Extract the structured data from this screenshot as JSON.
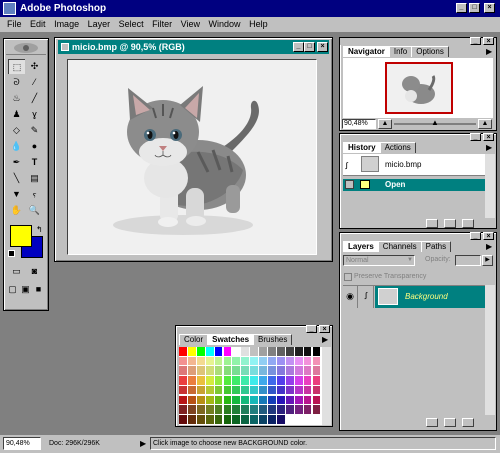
{
  "app": {
    "title": "Adobe Photoshop"
  },
  "menu": [
    "File",
    "Edit",
    "Image",
    "Layer",
    "Select",
    "Filter",
    "View",
    "Window",
    "Help"
  ],
  "document": {
    "title": "micio.bmp @ 90,5% (RGB)"
  },
  "navigator": {
    "tabs": [
      "Navigator",
      "Info",
      "Options"
    ],
    "zoom": "90,48%"
  },
  "history": {
    "tabs": [
      "History",
      "Actions"
    ],
    "items": [
      "micio.bmp",
      "Open"
    ]
  },
  "layers": {
    "tabs": [
      "Layers",
      "Channels",
      "Paths"
    ],
    "mode": "Normal",
    "opacity_label": "Opacity:",
    "preserve": "Preserve Transparency",
    "layer_name": "Background"
  },
  "swatches": {
    "tabs": [
      "Color",
      "Swatches",
      "Brushes"
    ]
  },
  "colors": {
    "foreground": "#ffff00",
    "background": "#0000c0",
    "titlebar": "#000080",
    "palette_title": "#008080"
  },
  "status": {
    "zoom": "90,48%",
    "doc": "Doc: 296K/296K",
    "message": "Click image to choose new BACKGROUND color."
  }
}
